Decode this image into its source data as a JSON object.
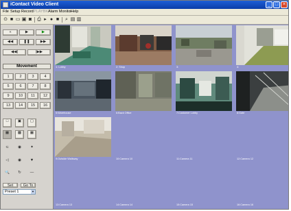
{
  "window": {
    "title": "iContact Video Client",
    "controls": [
      "_",
      "□",
      "×"
    ]
  },
  "menu": {
    "file": "File",
    "setup": "Setup",
    "record": "Record",
    "playback": "PLAYBK",
    "alarm": "Alarm Monitor",
    "help": "Help"
  },
  "toolbar": {
    "icons": [
      "open-icon",
      "camera-icon",
      "monitor-icon",
      "save-icon",
      "disk-icon",
      "print-icon",
      "play-icon",
      "record-icon",
      "stop-icon",
      "search-icon",
      "layout-icon",
      "display-icon"
    ]
  },
  "left_panel": {
    "playback_row1": [
      "«",
      "▶",
      "▶"
    ],
    "playback_row2": [
      "◀◀",
      "❚❚",
      "▶▶"
    ],
    "playback_row3": [
      "◀◀|",
      "|▶▶"
    ],
    "movement_label": "Movement",
    "keypad": [
      "1",
      "2",
      "3",
      "4",
      "5",
      "6",
      "7",
      "8",
      "9",
      "10",
      "11",
      "12",
      "13",
      "14",
      "15",
      "16"
    ],
    "layout_row1": [
      "□",
      "▣",
      "▢"
    ],
    "layout_row2": [
      "▦",
      "▩",
      "▦"
    ],
    "ptz_row1": [
      "⊂",
      "◉",
      "✦"
    ],
    "ptz_row2": [
      "◁",
      "◉",
      "▼"
    ],
    "ptz_row3": [
      "🔍",
      "↻",
      "—"
    ],
    "set_label": "Set",
    "goto_label": "Go To",
    "preset_value": "Preset 1"
  },
  "cameras": [
    {
      "label": "1: Lobby"
    },
    {
      "label": "2: Shop"
    },
    {
      "label": "3:"
    },
    {
      "label": "4:"
    },
    {
      "label": "5:Warehouse"
    },
    {
      "label": "6:Back Office"
    },
    {
      "label": "7:Customer Lobby"
    },
    {
      "label": "8:Gate"
    },
    {
      "label": "9:Outside Walkway"
    },
    {
      "label": "10:Camera 10"
    },
    {
      "label": "11:Camera 11"
    },
    {
      "label": "12:Camera 12"
    },
    {
      "label": "13:Camera 13"
    },
    {
      "label": "14:Camera 14"
    },
    {
      "label": "15:Camera 15"
    },
    {
      "label": "16:Camera 16"
    }
  ]
}
